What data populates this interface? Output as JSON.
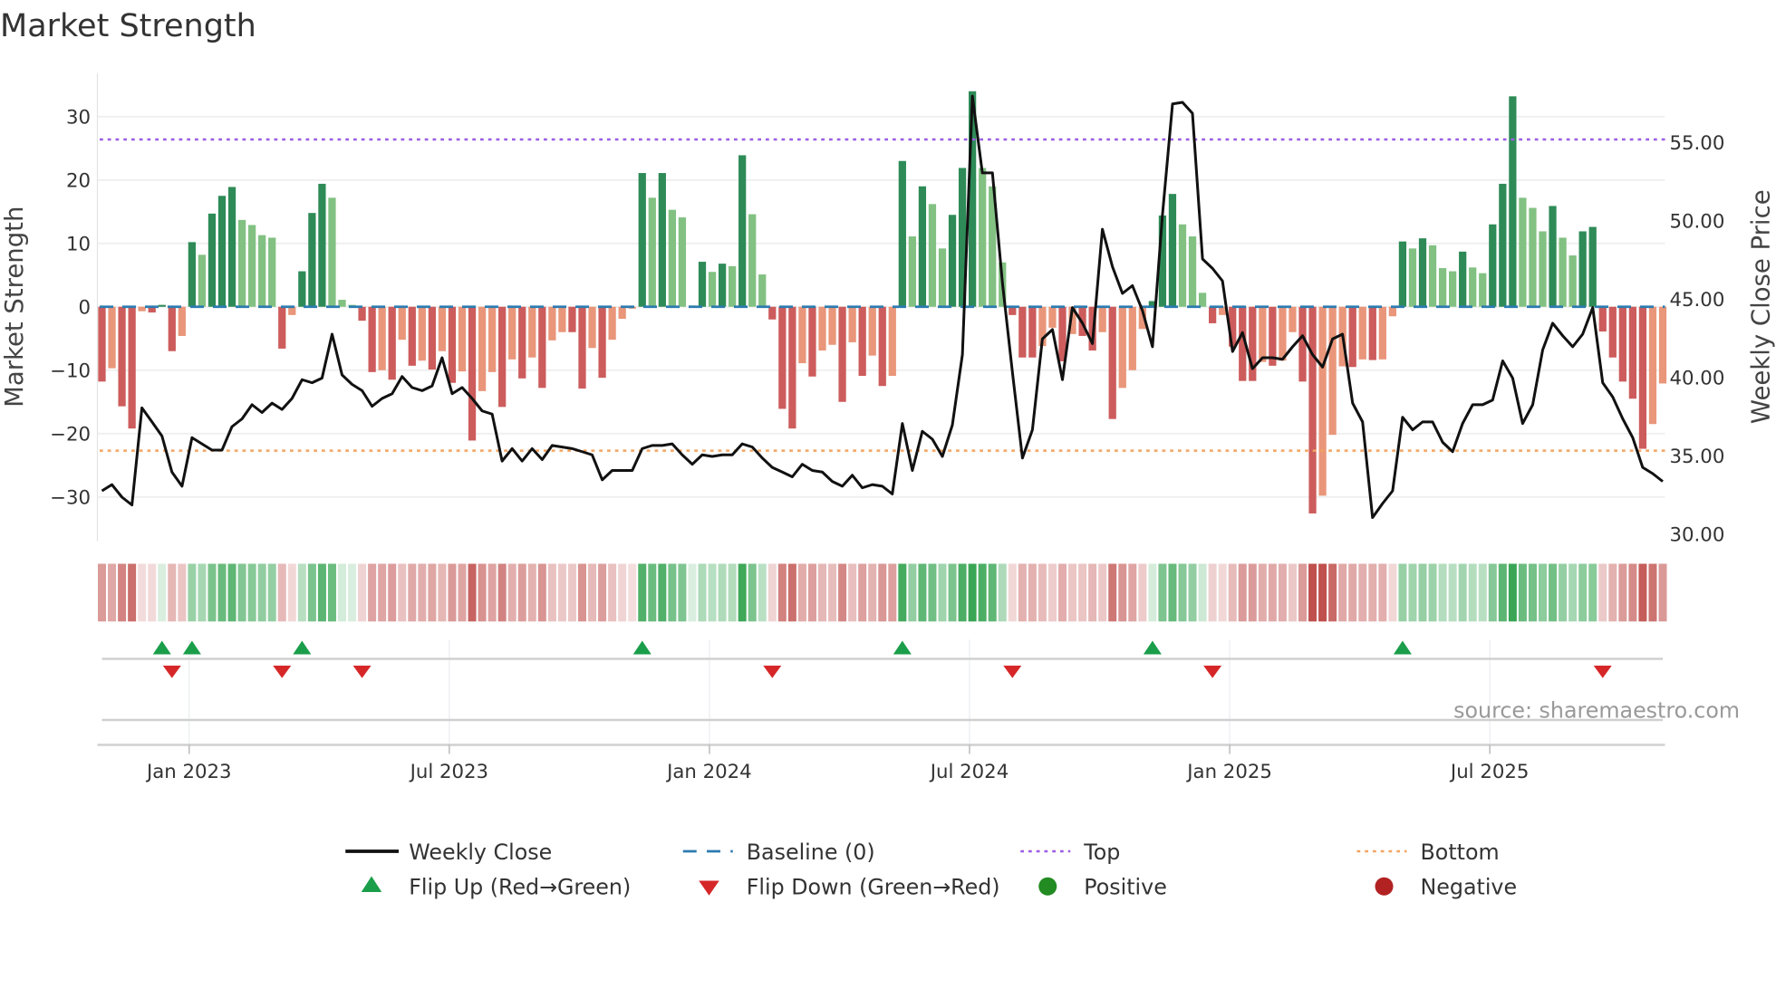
{
  "chart_data": {
    "type": "bar",
    "title": "Market Strength",
    "ylabel": "Market Strength",
    "y2label": "Weekly Close Price",
    "ylim": [
      -37,
      37
    ],
    "y2lim": [
      29,
      59
    ],
    "yticks": [
      30,
      20,
      10,
      0,
      -10,
      -20,
      -30
    ],
    "ytick_labels": [
      "30",
      "20",
      "10",
      "0",
      "−10",
      "−20",
      "−30"
    ],
    "y2ticks": [
      55,
      50,
      45,
      40,
      35,
      30
    ],
    "y2tick_labels": [
      "55.00",
      "50.00",
      "45.00",
      "40.00",
      "35.00",
      "30.00"
    ],
    "xtick_labels": [
      "Jan 2023",
      "Jul 2023",
      "Jan 2024",
      "Jul 2024",
      "Jan 2025",
      "Jul 2025"
    ],
    "xtick_week_index": [
      9,
      35,
      61,
      87,
      113,
      139
    ],
    "top_level": 26.4,
    "bottom_level": -22.7,
    "baseline": 0,
    "strength": [
      -11.8,
      -9.7,
      -15.7,
      -19.2,
      -0.7,
      -0.9,
      0.3,
      -7,
      -4.6,
      10.2,
      8.2,
      14.7,
      17.5,
      18.9,
      13.7,
      12.9,
      11.3,
      10.9,
      -6.6,
      -1.3,
      5.6,
      14.8,
      19.4,
      17.2,
      1.1,
      0.3,
      -2.2,
      -10.3,
      -10,
      -11.5,
      -5.2,
      -9.3,
      -8.5,
      -9.9,
      -7,
      -12,
      -10.2,
      -21.1,
      -13.3,
      -10.3,
      -15.8,
      -8.3,
      -11.3,
      -8,
      -12.8,
      -5.3,
      -4,
      -4,
      -12.9,
      -6.5,
      -11.2,
      -5.2,
      -1.9,
      -0.3,
      21.1,
      17.2,
      21.1,
      15.3,
      14.1,
      0.2,
      7.1,
      5.5,
      6.8,
      6.4,
      23.9,
      14.6,
      5.1,
      -2,
      -16.1,
      -19.2,
      -8.9,
      -11,
      -6.9,
      -6,
      -15,
      -5.6,
      -10.9,
      -7.7,
      -12.5,
      -10.9,
      23,
      11.1,
      19,
      16.2,
      9.2,
      14.5,
      21.9,
      34,
      21.9,
      19,
      7,
      -1.3,
      -8,
      -8,
      -6.2,
      -3.3,
      -8.6,
      -4.3,
      -4.6,
      -6.9,
      -4,
      -17.7,
      -12.8,
      -10,
      -3.5,
      0.9,
      14.4,
      17.8,
      13,
      11.1,
      2.2,
      -2.6,
      -1.3,
      -6.3,
      -11.7,
      -11.7,
      -8.7,
      -9.3,
      -8.5,
      -4,
      -11.8,
      -32.6,
      -29.8,
      -20.2,
      -9.4,
      -9.5,
      -8.3,
      -8.4,
      -8.3,
      -1.5,
      10.3,
      9.2,
      10.8,
      9.7,
      6.1,
      5.6,
      8.7,
      6.2,
      5.3,
      13,
      19.4,
      33.2,
      17.2,
      15.6,
      11.9,
      15.9,
      10.9,
      8.1,
      11.9,
      12.6,
      -3.9,
      -8,
      -11.8,
      -14.5,
      -22.4,
      -18.5,
      -12.1
    ],
    "weekly_close": [
      32.7,
      33.1,
      32.3,
      31.8,
      38.0,
      37.1,
      36.2,
      33.9,
      33.0,
      36.1,
      35.7,
      35.3,
      35.3,
      36.8,
      37.3,
      38.2,
      37.7,
      38.3,
      37.9,
      38.6,
      39.8,
      39.6,
      39.9,
      42.7,
      40.1,
      39.5,
      39.1,
      38.1,
      38.6,
      38.9,
      40.0,
      39.3,
      39.1,
      39.4,
      41.2,
      38.9,
      39.3,
      38.6,
      37.8,
      37.6,
      34.6,
      35.4,
      34.6,
      35.4,
      34.7,
      35.6,
      35.5,
      35.4,
      35.2,
      35.0,
      33.4,
      34.0,
      34.0,
      34.0,
      35.4,
      35.6,
      35.6,
      35.7,
      35.0,
      34.4,
      35.0,
      34.9,
      35.0,
      35.0,
      35.7,
      35.5,
      34.8,
      34.2,
      33.9,
      33.6,
      34.4,
      34.0,
      33.9,
      33.3,
      33.0,
      33.7,
      32.9,
      33.1,
      33.0,
      32.5,
      37.0,
      34.0,
      36.5,
      36.0,
      34.9,
      36.9,
      41.4,
      57.9,
      53.0,
      53.0,
      46.0,
      40.3,
      34.8,
      36.6,
      42.4,
      43.0,
      39.8,
      44.4,
      43.4,
      42.1,
      49.4,
      47.0,
      45.3,
      45.8,
      44.2,
      41.9,
      50.3,
      57.4,
      57.5,
      56.8,
      47.5,
      46.9,
      46.1,
      41.6,
      42.8,
      40.5,
      41.2,
      41.2,
      41.1,
      41.9,
      42.6,
      41.4,
      40.6,
      42.4,
      42.7,
      38.3,
      37.1,
      31.0,
      31.9,
      32.7,
      37.4,
      36.6,
      37.1,
      37.1,
      35.8,
      35.2,
      37.0,
      38.2,
      38.2,
      38.5,
      41.0,
      39.9,
      37.0,
      38.2,
      41.7,
      43.4,
      42.6,
      41.9,
      42.7,
      44.4,
      39.6,
      38.7,
      37.3,
      36.1,
      34.2,
      33.8,
      33.3
    ],
    "legend": [
      {
        "label": "Weekly Close",
        "kind": "line"
      },
      {
        "label": "Baseline (0)",
        "kind": "dash"
      },
      {
        "label": "Top",
        "kind": "dot-top"
      },
      {
        "label": "Bottom",
        "kind": "dot-bottom"
      },
      {
        "label": "Flip Up (Red→Green)",
        "kind": "tri-up"
      },
      {
        "label": "Flip Down (Green→Red)",
        "kind": "tri-down"
      },
      {
        "label": "Positive",
        "kind": "dot-pos"
      },
      {
        "label": "Negative",
        "kind": "dot-neg"
      }
    ],
    "legend_position": "bottom",
    "source": "source: sharemaestro.com"
  },
  "colors": {
    "pos_dark": "#2e8b57",
    "pos_light": "#82c182",
    "neg_dark": "#cd5c5c",
    "neg_light": "#e9967a",
    "line": "#111111",
    "baseline": "#2c7bb0",
    "top": "#9b5de5",
    "bottom": "#f4a460",
    "flip_up": "#1a9e4a",
    "flip_down": "#d62728",
    "positive": "#228b22",
    "negative": "#b22222"
  }
}
